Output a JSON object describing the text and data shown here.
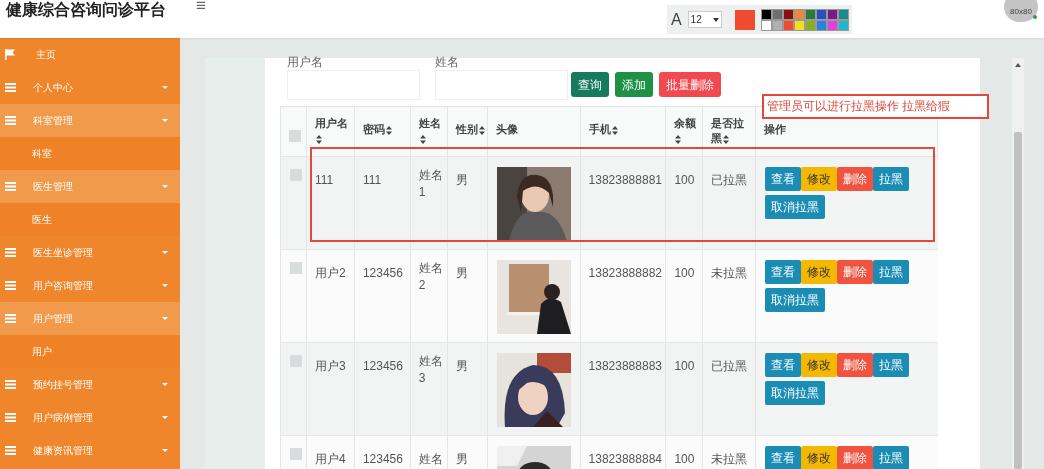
{
  "header": {
    "title": "健康综合咨询问诊平台",
    "menu_glyph": "≡",
    "font_label": "A",
    "font_size": "12",
    "current": {
      "color": "#f04a30"
    },
    "palette": [
      {
        "color": "#000000"
      },
      {
        "color": "#6e6e6e"
      },
      {
        "color": "#8b0f0f"
      },
      {
        "color": "#e88a3a"
      },
      {
        "color": "#2a7a3a"
      },
      {
        "color": "#2a4fc0"
      },
      {
        "color": "#7a1a8a"
      },
      {
        "color": "#1a8a8a"
      },
      {
        "color": "#ffffff"
      },
      {
        "color": "#b0b0b0"
      },
      {
        "color": "#f04a30"
      },
      {
        "color": "#f0e020"
      },
      {
        "color": "#8ab020"
      },
      {
        "color": "#2a80e0"
      },
      {
        "color": "#e040e0"
      },
      {
        "color": "#20b8c8"
      }
    ],
    "avatar_text": "80x80"
  },
  "sidebar": {
    "items": [
      {
        "label": "主页",
        "kind": "home"
      },
      {
        "label": "个人中心",
        "kind": "group",
        "expanded": false
      },
      {
        "label": "科室管理",
        "kind": "group",
        "expanded": true,
        "children": [
          {
            "label": "科室"
          }
        ]
      },
      {
        "label": "医生管理",
        "kind": "group",
        "expanded": true,
        "children": [
          {
            "label": "医生"
          }
        ]
      },
      {
        "label": "医生坐诊管理",
        "kind": "group",
        "expanded": false
      },
      {
        "label": "用户咨询管理",
        "kind": "group",
        "expanded": false
      },
      {
        "label": "用户管理",
        "kind": "group",
        "expanded": true,
        "children": [
          {
            "label": "用户"
          }
        ]
      },
      {
        "label": "预约挂号管理",
        "kind": "group",
        "expanded": false
      },
      {
        "label": "用户病例管理",
        "kind": "group",
        "expanded": false
      },
      {
        "label": "健康资讯管理",
        "kind": "group",
        "expanded": false
      }
    ]
  },
  "search": {
    "fields": [
      {
        "label": "用户名"
      },
      {
        "label": "姓名"
      }
    ],
    "buttons": [
      {
        "label": "查询",
        "kind": "query"
      },
      {
        "label": "添加",
        "kind": "add"
      },
      {
        "label": "批量删除",
        "kind": "delete"
      }
    ]
  },
  "annotation": {
    "text": "管理员可以进行拉黑操作 拉黑给猳"
  },
  "table": {
    "select_all": {
      "checked": false
    },
    "columns": [
      {
        "label": "用户名",
        "sortable": true
      },
      {
        "label": "密码",
        "sortable": true
      },
      {
        "label": "姓名",
        "sortable": true
      },
      {
        "label": "性别",
        "sortable": true
      },
      {
        "label": "头像",
        "sortable": false
      },
      {
        "label": "手机",
        "sortable": true
      },
      {
        "label": "余额",
        "sortable": true
      },
      {
        "label": "是否拉黑",
        "sortable": true
      },
      {
        "label": "操作",
        "sortable": false
      }
    ],
    "rows": [
      {
        "checked": false,
        "highlighted": true,
        "cells": [
          "111",
          "111",
          "姓名1",
          "男",
          {
            "kind": "picture"
          },
          "13823888881",
          "100",
          "已拉黑"
        ],
        "actions": [
          {
            "label": "查看",
            "kind": "view"
          },
          {
            "label": "修改",
            "kind": "edit"
          },
          {
            "label": "删除",
            "kind": "delete"
          },
          {
            "label": "拉黑",
            "kind": "block"
          },
          {
            "label": "取消拉黑",
            "kind": "block"
          }
        ]
      },
      {
        "checked": false,
        "highlighted": false,
        "cells": [
          "用户2",
          "123456",
          "姓名2",
          "男",
          {
            "kind": "picture"
          },
          "13823888882",
          "100",
          "未拉黑"
        ],
        "actions": [
          {
            "label": "查看",
            "kind": "view"
          },
          {
            "label": "修改",
            "kind": "edit"
          },
          {
            "label": "删除",
            "kind": "delete"
          },
          {
            "label": "拉黑",
            "kind": "block"
          },
          {
            "label": "取消拉黑",
            "kind": "block"
          }
        ]
      },
      {
        "checked": false,
        "highlighted": false,
        "cells": [
          "用户3",
          "123456",
          "姓名3",
          "男",
          {
            "kind": "picture"
          },
          "13823888883",
          "100",
          "已拉黑"
        ],
        "actions": [
          {
            "label": "查看",
            "kind": "view"
          },
          {
            "label": "修改",
            "kind": "edit"
          },
          {
            "label": "删除",
            "kind": "delete"
          },
          {
            "label": "拉黑",
            "kind": "block"
          },
          {
            "label": "取消拉黑",
            "kind": "block"
          }
        ]
      },
      {
        "checked": false,
        "highlighted": false,
        "cells": [
          "用户4",
          "123456",
          "姓名",
          "男",
          {
            "kind": "picture"
          },
          "13823888884",
          "100",
          "未拉黑"
        ],
        "actions": [
          {
            "label": "查看",
            "kind": "view"
          },
          {
            "label": "修改",
            "kind": "edit"
          },
          {
            "label": "删除",
            "kind": "delete"
          },
          {
            "label": "拉黑",
            "kind": "block"
          }
        ]
      }
    ]
  }
}
